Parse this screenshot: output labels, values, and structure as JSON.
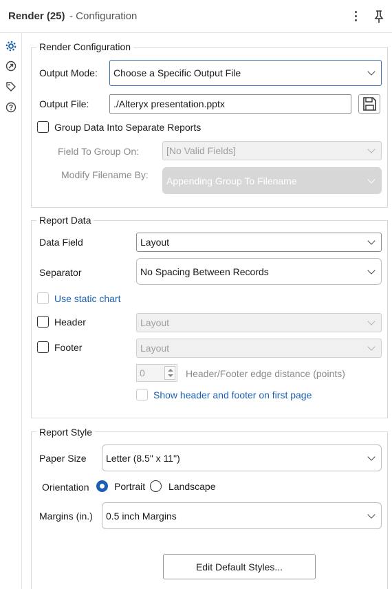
{
  "header": {
    "title": "Render (25)",
    "subtitle": "- Configuration"
  },
  "render_config": {
    "legend": "Render Configuration",
    "output_mode_label": "Output Mode:",
    "output_mode_value": "Choose a Specific Output File",
    "output_file_label": "Output File:",
    "output_file_value": "./Alteryx presentation.pptx",
    "group_data_label": "Group Data Into Separate Reports",
    "field_to_group_label": "Field To Group On:",
    "field_to_group_value": "[No Valid Fields]",
    "modify_filename_label": "Modify Filename By:",
    "modify_filename_value": "Appending Group To Filename"
  },
  "report_data": {
    "legend": "Report Data",
    "data_field_label": "Data Field",
    "data_field_value": "Layout",
    "separator_label": "Separator",
    "separator_value": "No Spacing Between Records",
    "static_chart_label": "Use static chart",
    "header_label": "Header",
    "header_value": "Layout",
    "footer_label": "Footer",
    "footer_value": "Layout",
    "edge_distance_value": "0",
    "edge_distance_label": "Header/Footer edge distance (points)",
    "show_first_page_label": "Show header and footer on first page"
  },
  "report_style": {
    "legend": "Report Style",
    "paper_size_label": "Paper Size",
    "paper_size_value": "Letter (8.5\" x 11\")",
    "orientation_label": "Orientation",
    "portrait_label": "Portrait",
    "landscape_label": "Landscape",
    "orientation_selected": "Portrait",
    "margins_label": "Margins (in.)",
    "margins_value": "0.5 inch Margins",
    "edit_styles_label": "Edit Default Styles..."
  },
  "icons": [
    "gear-icon",
    "input-output-icon",
    "tag-icon",
    "help-icon",
    "more-options-icon",
    "pin-icon",
    "save-icon"
  ],
  "colors": {
    "accent": "#1a5fb4",
    "focus_border": "#3b6fb6"
  }
}
